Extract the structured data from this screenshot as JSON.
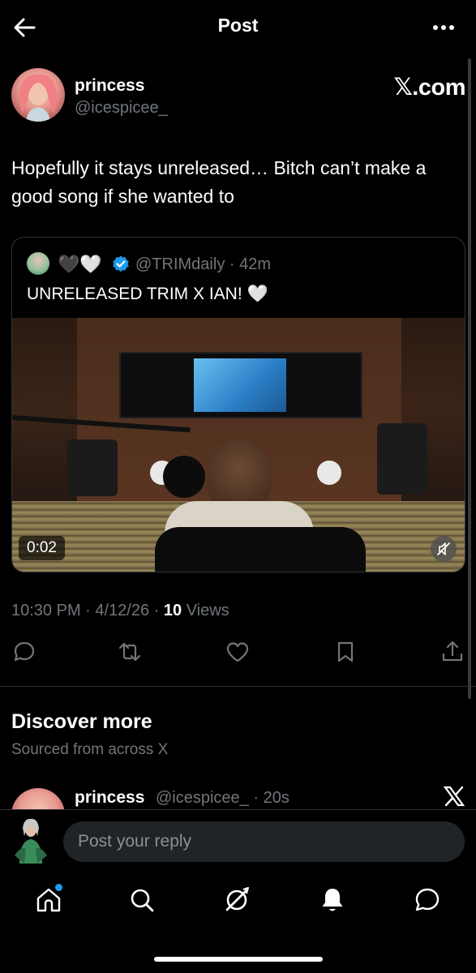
{
  "header": {
    "title": "Post"
  },
  "post": {
    "author_name": "princess",
    "author_handle": "@icespicee_",
    "watermark": "𝕏.com",
    "text": "Hopefully it stays unreleased… Bitch can’t make a good song if she wanted to",
    "timestamp": "10:30 PM · 4/12/26 · ",
    "views_count": "10",
    "views_label": " Views"
  },
  "quote": {
    "hearts": "🖤🤍",
    "handle_time": "@TRIMdaily · 42m",
    "text": "UNRELEASED TRIM X IAN! 🤍",
    "video_time": "0:02"
  },
  "discover": {
    "title": "Discover more",
    "subtitle": "Sourced from across X"
  },
  "next_post": {
    "author_name": "princess",
    "handle_time": "@icespicee_ · 20s"
  },
  "reply": {
    "placeholder": "Post your reply"
  },
  "colors": {
    "background": "#000000",
    "text": "#e7e9ea",
    "muted": "#71767b",
    "accent": "#1d9bf0",
    "border": "#2f3336"
  },
  "icons": [
    "back-arrow-icon",
    "more-icon",
    "verified-badge-icon",
    "mute-icon",
    "reply-icon",
    "repost-icon",
    "like-icon",
    "bookmark-icon",
    "share-icon",
    "x-logo-icon",
    "home-icon",
    "search-icon",
    "grok-icon",
    "notifications-icon",
    "messages-icon"
  ]
}
